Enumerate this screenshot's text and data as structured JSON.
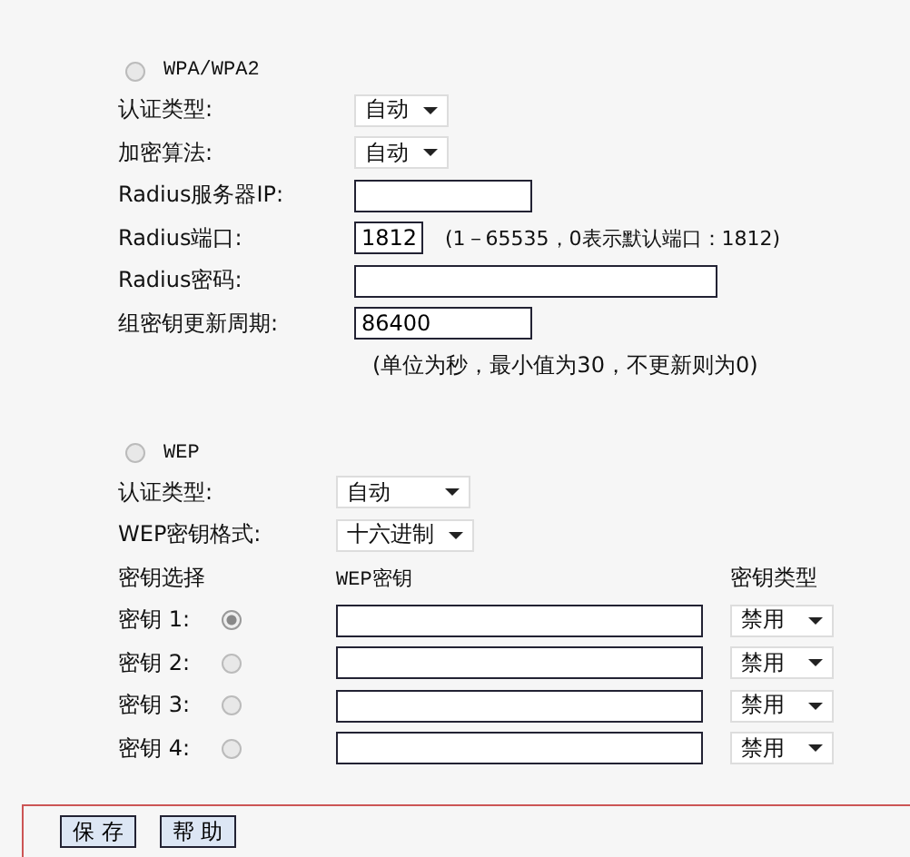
{
  "wpa": {
    "label": "WPA/WPA2",
    "selected": false,
    "fields": [
      {
        "kind": "select",
        "label": "认证类型:",
        "value": "自动"
      },
      {
        "kind": "select",
        "label": "加密算法:",
        "value": "自动"
      },
      {
        "kind": "text",
        "label": "Radius服务器IP:"
      },
      {
        "kind": "number",
        "label": "Radius端口:",
        "value": "1812",
        "note": "(1－65535，0表示默认端口：1812)"
      },
      {
        "kind": "wide",
        "label": "Radius密码:"
      },
      {
        "kind": "text",
        "label": "组密钥更新周期:",
        "value": "86400"
      }
    ],
    "note": "(单位为秒，最小值为30，不更新则为0)"
  },
  "wep": {
    "label": "WEP",
    "selected": false,
    "fields": [
      {
        "kind": "select",
        "label": "认证类型:",
        "value": "自动"
      },
      {
        "kind": "select",
        "label": "WEP密钥格式:",
        "value": "十六进制"
      }
    ],
    "headers": [
      "密钥选择",
      "WEP密钥",
      "密钥类型"
    ],
    "keys": [
      {
        "label": "密钥 1:",
        "selected": true,
        "type": "禁用"
      },
      {
        "label": "密钥 2:",
        "selected": false,
        "type": "禁用"
      },
      {
        "label": "密钥 3:",
        "selected": false,
        "type": "禁用"
      },
      {
        "label": "密钥 4:",
        "selected": false,
        "type": "禁用"
      }
    ]
  },
  "buttons": [
    "保 存",
    "帮 助"
  ]
}
